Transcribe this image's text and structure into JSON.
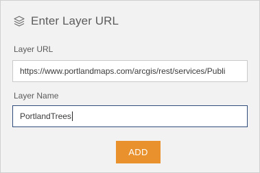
{
  "header": {
    "title": "Enter Layer URL",
    "icon": "layers-icon"
  },
  "layer_url": {
    "label": "Layer URL",
    "value": "https://www.portlandmaps.com/arcgis/rest/services/Publi"
  },
  "layer_name": {
    "label": "Layer Name",
    "value": "PortlandTrees"
  },
  "add_button": {
    "label": "ADD"
  },
  "colors": {
    "panel_bg": "#f2f2f2",
    "accent": "#e8912d",
    "focus_border": "#2e4a7a"
  }
}
